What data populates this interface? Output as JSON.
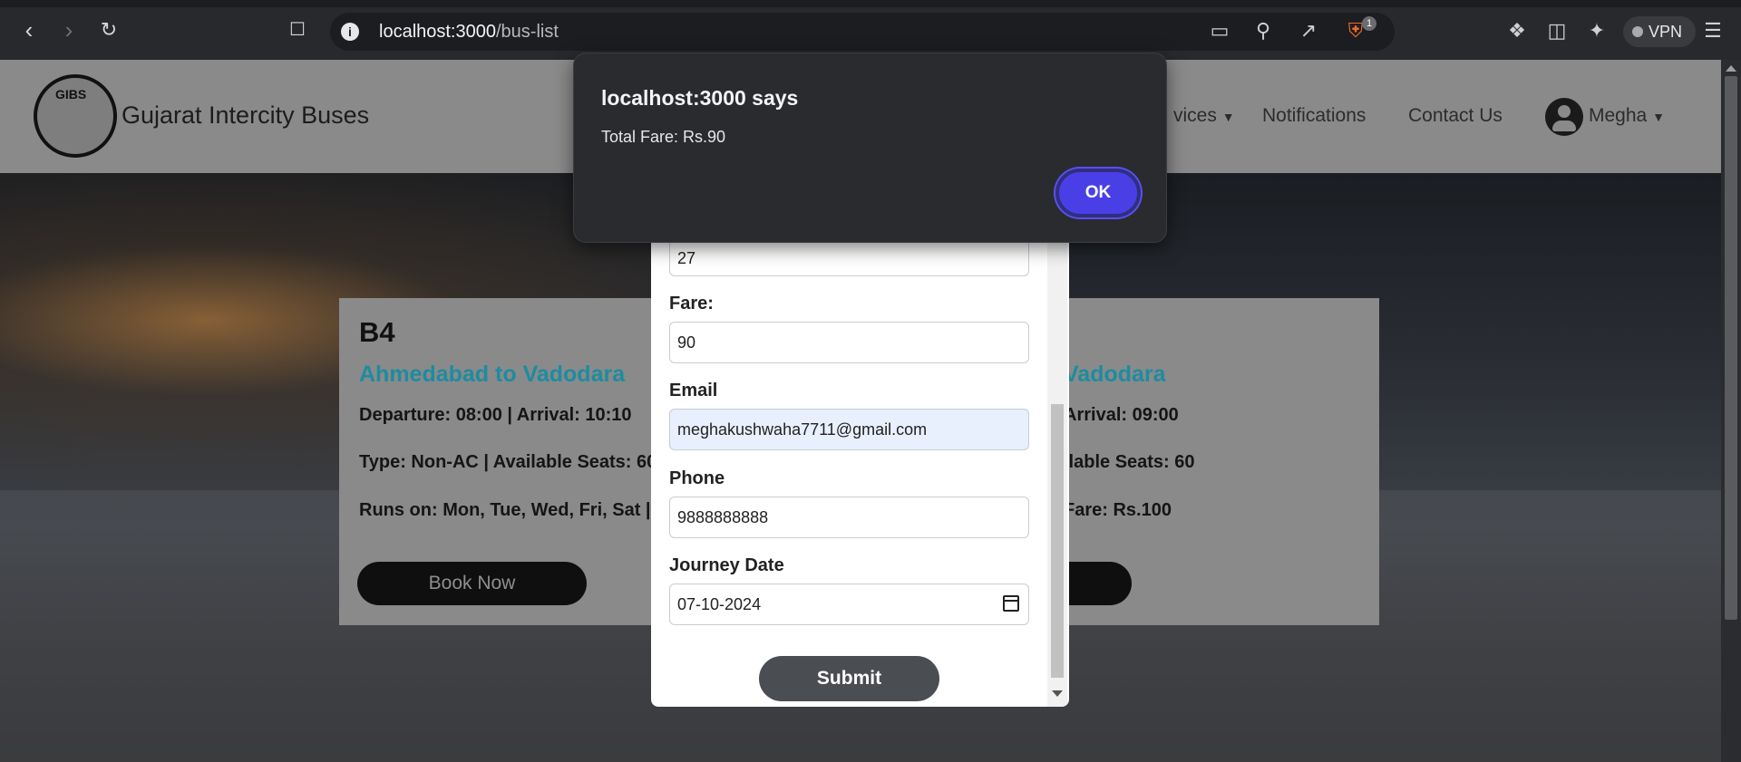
{
  "browser": {
    "url_host": "localhost:3000",
    "url_path": "/bus-list",
    "vpn_label": "VPN",
    "shield_badge": "1",
    "icons": [
      "back-icon",
      "forward-icon",
      "reload-icon",
      "bookmark-icon",
      "site-info-icon",
      "cast-icon",
      "zoom-out-icon",
      "share-icon",
      "brave-shield-icon",
      "extensions-icon",
      "sidebar-icon",
      "leo-ai-icon",
      "menu-icon"
    ]
  },
  "navbar": {
    "logo_text": "GIBS",
    "brand": "Gujarat Intercity Buses",
    "services_partial": "vices",
    "notifications": "Notifications",
    "contact": "Contact Us",
    "user": "Megha"
  },
  "cards": [
    {
      "id": "B4",
      "route": "Ahmedabad to Vadodara",
      "times": "Departure: 08:00 | Arrival: 10:10",
      "type_seats": "Type: Non-AC | Available Seats: 60",
      "runs_on": "Runs on: Mon, Tue, Wed, Fri, Sat | F",
      "book_label": "Book Now"
    },
    {
      "route_partial": "Vadodara",
      "times_partial": "Arrival: 09:00",
      "seats_partial": "ilable Seats: 60",
      "fare_partial": "Fare: Rs.100"
    }
  ],
  "form": {
    "seat_value": "27",
    "fare_label": "Fare:",
    "fare_value": "90",
    "email_label": "Email",
    "email_value": "meghakushwaha7711@gmail.com",
    "phone_label": "Phone",
    "phone_value": "9888888888",
    "date_label": "Journey Date",
    "date_value": "07-10-2024",
    "submit_label": "Submit"
  },
  "alert": {
    "title": "localhost:3000 says",
    "message": "Total Fare: Rs.90",
    "ok_label": "OK"
  },
  "colors": {
    "accent_route": "#1d8ca0",
    "alert_ok": "#4a3fe6",
    "navbar_bg": "#8a8a8a"
  }
}
